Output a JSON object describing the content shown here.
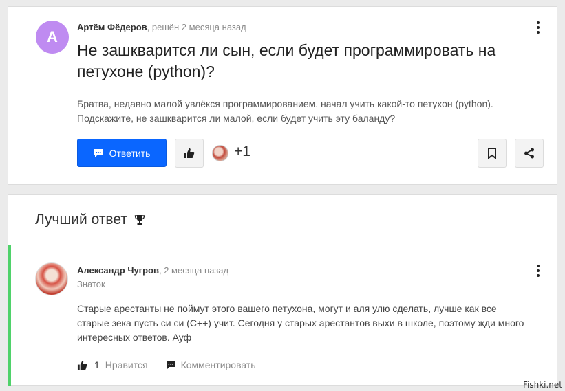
{
  "question": {
    "avatar_letter": "A",
    "author": "Артём Фёдеров",
    "meta": ", решён 2 месяца назад",
    "title": "Не зашкварится ли сын, если будет программировать на петухоне (python)?",
    "body": "Братва, недавно малой увлёкся программированием. начал учить какой-то петухон (python). Подскажите, не зашкварится ли малой, если будет учить эту баланду?",
    "reply_label": "Ответить",
    "likes": "+1"
  },
  "best_answer": {
    "heading": "Лучший ответ",
    "author": "Александр Чугров",
    "meta": ", 2 месяца назад",
    "rank": "Знаток",
    "body": "Старые арестанты не поймут этого вашего петухона, могут и аля улю сделать, лучше как все старые зека пусть си си (С++) учит. Сегодня у старых арестантов выхи в школе, поэтому жди много интересных ответов. Ауф",
    "like_count": "1",
    "like_label": "Нравится",
    "comment_label": "Комментировать"
  },
  "watermark": "Fishki.net",
  "colors": {
    "primary": "#0a66ff",
    "avatar_bg": "#bf8bf1",
    "best_answer_accent": "#4fd26a"
  }
}
